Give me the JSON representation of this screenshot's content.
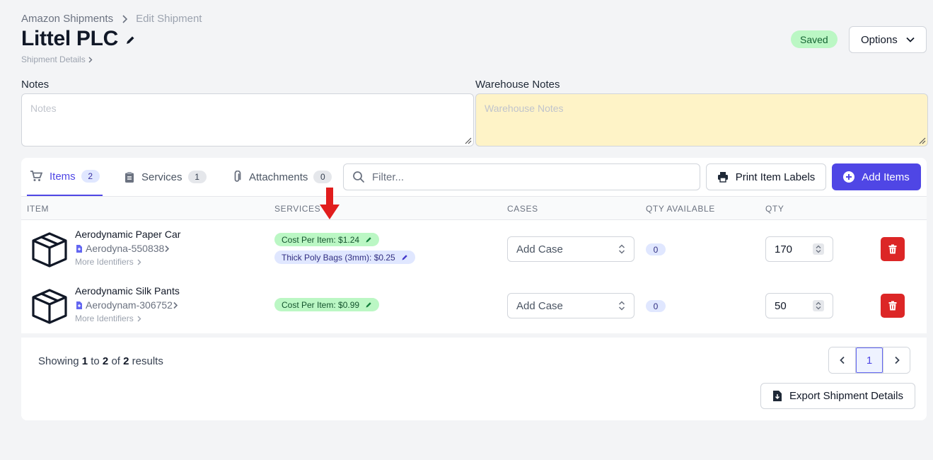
{
  "breadcrumb": {
    "parent": "Amazon Shipments",
    "current": "Edit Shipment"
  },
  "page": {
    "title": "Littel PLC",
    "details_link": "Shipment Details",
    "status": "Saved",
    "options_label": "Options"
  },
  "notes": {
    "label": "Notes",
    "placeholder": "Notes",
    "value": ""
  },
  "warehouse_notes": {
    "label": "Warehouse Notes",
    "placeholder": "Warehouse Notes",
    "value": ""
  },
  "tabs": [
    {
      "label": "Items",
      "count": "2",
      "active": true,
      "icon": "cart-icon"
    },
    {
      "label": "Services",
      "count": "1",
      "active": false,
      "icon": "clipboard-icon"
    },
    {
      "label": "Attachments",
      "count": "0",
      "active": false,
      "icon": "paperclip-icon"
    }
  ],
  "filter": {
    "placeholder": "Filter...",
    "value": ""
  },
  "toolbar": {
    "print_label": "Print Item Labels",
    "add_label": "Add Items"
  },
  "columns": {
    "item": "ITEM",
    "services": "SERVICES",
    "cases": "CASES",
    "qty_available": "QTY AVAILABLE",
    "qty": "QTY"
  },
  "items": [
    {
      "name": "Aerodynamic Paper Car",
      "identifier": "Aerodyna-550838",
      "more": "More Identifiers",
      "services": [
        "Cost Per Item: $1.24",
        "Thick Poly Bags (3mm): $0.25"
      ],
      "case_placeholder": "Add Case",
      "qty_available": "0",
      "qty": "170"
    },
    {
      "name": "Aerodynamic Silk Pants",
      "identifier": "Aerodynam-306752",
      "more": "More Identifiers",
      "services": [
        "Cost Per Item: $0.99"
      ],
      "case_placeholder": "Add Case",
      "qty_available": "0",
      "qty": "50"
    }
  ],
  "pagination": {
    "prefix": "Showing",
    "from": "1",
    "to_word": "to",
    "to": "2",
    "of_word": "of",
    "total": "2",
    "suffix": "results",
    "current_page": "1"
  },
  "footer": {
    "export_label": "Export Shipment Details"
  },
  "colors": {
    "accent": "#4f46e5",
    "saved_bg": "#bbf7c4",
    "danger": "#dc2626",
    "warehouse_bg": "#fef3c7",
    "annotation": "#e11d1d"
  }
}
